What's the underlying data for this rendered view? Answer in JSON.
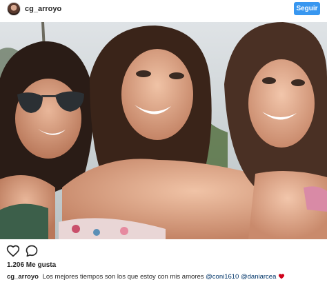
{
  "header": {
    "username": "cg_arroyo",
    "follow_label": "Seguir"
  },
  "photo": {
    "avatar_icon": "profile-avatar",
    "subject": "photo"
  },
  "actions": {
    "like_icon": "heart-outline-icon",
    "comment_icon": "comment-bubble-icon"
  },
  "likes": {
    "text": "1.206 Me gusta"
  },
  "caption": {
    "username": "cg_arroyo",
    "text": "Los mejores tiempos son los que estoy con mis amores",
    "mentions": [
      "@coni1610",
      "@daniarcea"
    ],
    "emoji": "red-heart-emoji"
  },
  "colors": {
    "accent": "#3897f0",
    "text": "#262626",
    "heart": "#ed4956",
    "mention": "#003569"
  }
}
